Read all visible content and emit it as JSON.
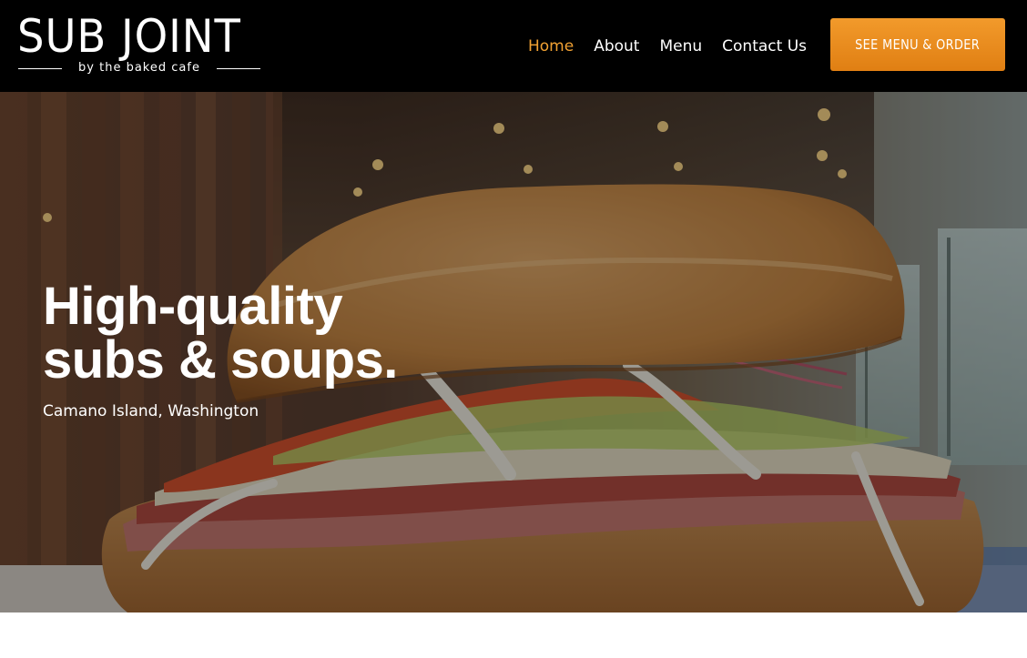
{
  "header": {
    "logo": {
      "title": "SUB JOINT",
      "subtitle": "by the baked cafe"
    },
    "nav": [
      {
        "label": "Home",
        "active": true
      },
      {
        "label": "About",
        "active": false
      },
      {
        "label": "Menu",
        "active": false
      },
      {
        "label": "Contact Us",
        "active": false
      }
    ],
    "cta_label": "SEE MENU & ORDER"
  },
  "hero": {
    "title_line1": "High-quality",
    "title_line2": "subs & soups.",
    "location": "Camano Island, Washington"
  },
  "colors": {
    "header_bg": "#000000",
    "accent": "#f2a233",
    "cta_top": "#f29a2b",
    "cta_bottom": "#e07f13"
  }
}
